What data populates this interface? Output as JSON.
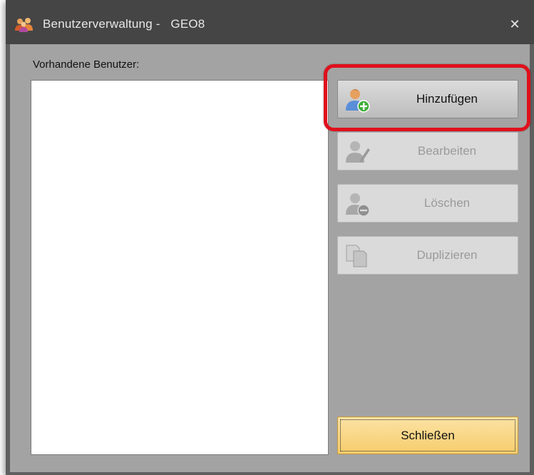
{
  "window": {
    "title": "Benutzerverwaltung -   GEO8",
    "close_symbol": "✕",
    "icon": "users-group-icon"
  },
  "main": {
    "list_label": "Vorhandene Benutzer:",
    "users": []
  },
  "actions": {
    "add": {
      "label": "Hinzufügen",
      "icon": "user-add-icon",
      "enabled": true
    },
    "edit": {
      "label": "Bearbeiten",
      "icon": "user-edit-icon",
      "enabled": false
    },
    "delete": {
      "label": "Löschen",
      "icon": "user-remove-icon",
      "enabled": false
    },
    "duplicate": {
      "label": "Duplizieren",
      "icon": "duplicate-icon",
      "enabled": false
    },
    "close": {
      "label": "Schließen",
      "icon": null,
      "enabled": true
    }
  },
  "colors": {
    "highlight": "#e0101c",
    "close_button": "#f7cd6c",
    "window_frame": "#5f5f5f",
    "client_bg": "#a3a3a3"
  }
}
